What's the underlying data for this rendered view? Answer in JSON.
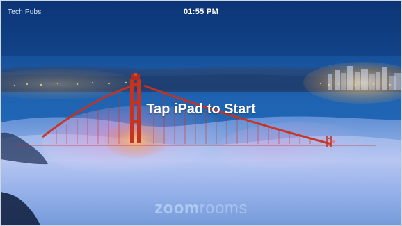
{
  "status_bar": {
    "room_name": "Tech Pubs",
    "time": "01:55 PM"
  },
  "main": {
    "prompt": "Tap iPad to Start"
  },
  "brand": {
    "part1": "zoom",
    "part2": "rooms"
  },
  "background": {
    "scene": "golden-gate-bridge-fog",
    "sky_color": "#1a58a8",
    "fog_color": "#c7d7ff",
    "bridge_color": "#c9321f"
  }
}
